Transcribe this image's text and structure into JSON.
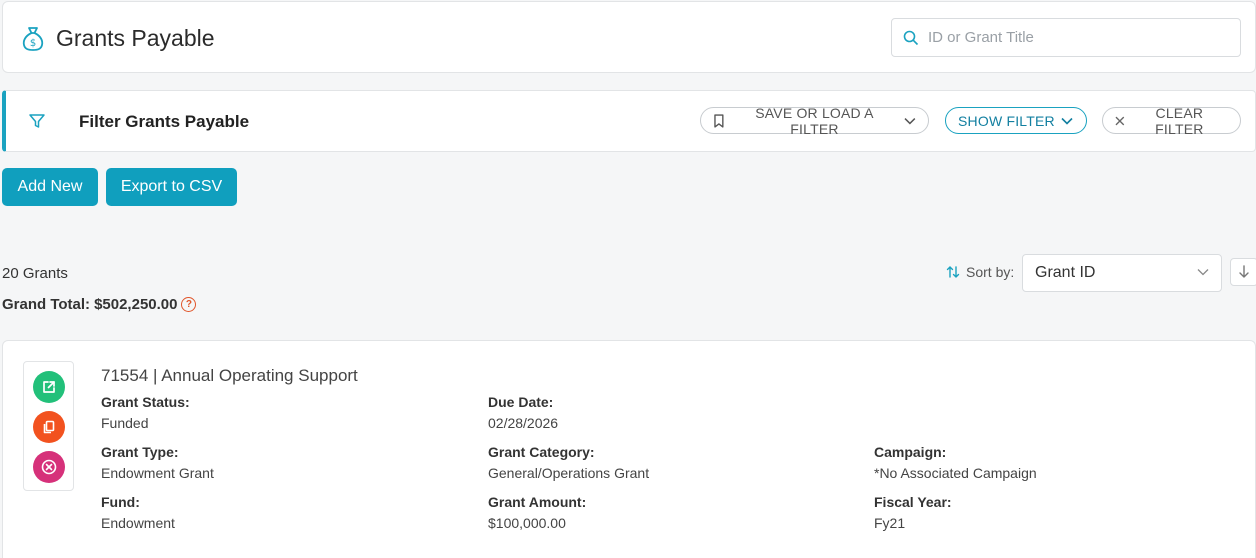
{
  "header": {
    "title": "Grants Payable",
    "search_placeholder": "ID or Grant Title"
  },
  "filter": {
    "title": "Filter Grants Payable",
    "save_load": "SAVE OR LOAD A FILTER",
    "show": "SHOW FILTER",
    "clear": "CLEAR FILTER"
  },
  "actions": {
    "add_new": "Add New",
    "export_csv": "Export to CSV"
  },
  "summary": {
    "count": "20 Grants",
    "grand_total_label": "Grand Total:",
    "grand_total_value": "$502,250.00",
    "help_glyph": "?"
  },
  "sort": {
    "label": "Sort by:",
    "selected": "Grant ID"
  },
  "grant": {
    "title": "71554 | Annual Operating Support",
    "fields": {
      "status_label": "Grant Status:",
      "status_value": "Funded",
      "due_label": "Due Date:",
      "due_value": "02/28/2026",
      "type_label": "Grant Type:",
      "type_value": "Endowment Grant",
      "category_label": "Grant Category:",
      "category_value": "General/Operations Grant",
      "campaign_label": "Campaign:",
      "campaign_value": "*No Associated Campaign",
      "fund_label": "Fund:",
      "fund_value": "Endowment",
      "amount_label": "Grant Amount:",
      "amount_value": "$100,000.00",
      "fy_label": "Fiscal Year:",
      "fy_value": "Fy21"
    }
  },
  "colors": {
    "accent": "#109fbe",
    "open": "#22c07a",
    "copy": "#f2521f",
    "delete": "#d6317a",
    "help": "#e0552a"
  },
  "icons": [
    "money-bag-icon",
    "search-icon",
    "funnel-icon",
    "bookmark-icon",
    "chevron-down-icon",
    "close-icon",
    "sort-icon",
    "arrow-down-icon",
    "external-link-icon",
    "copy-icon",
    "delete-circle-icon",
    "help-icon"
  ]
}
